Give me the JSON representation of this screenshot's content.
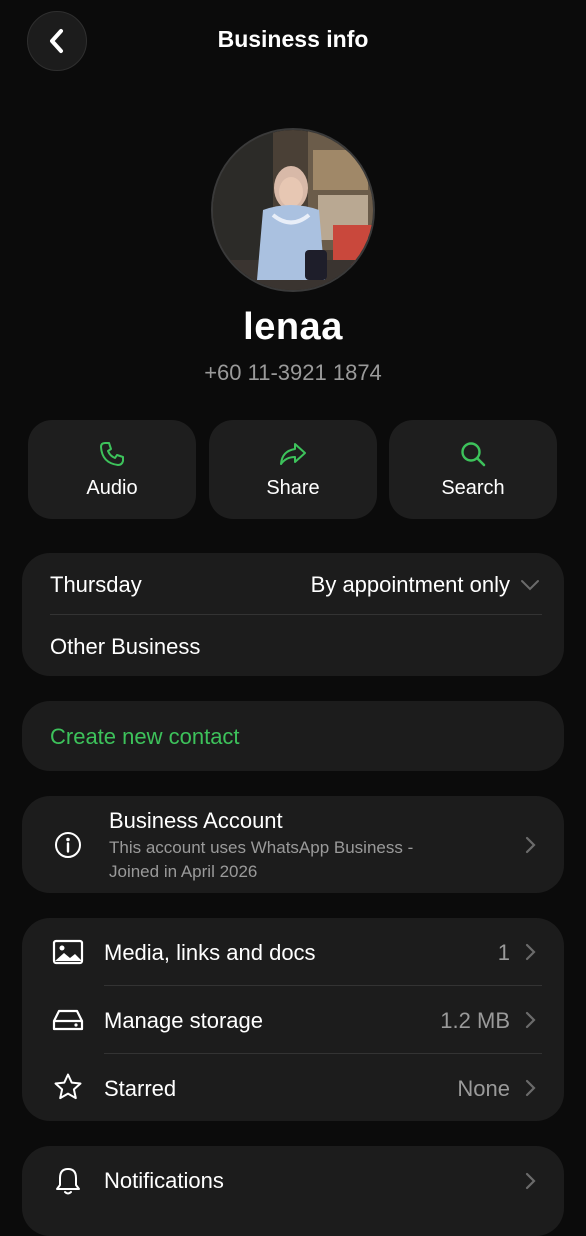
{
  "header": {
    "title": "Business info"
  },
  "profile": {
    "name": "lenaa",
    "phone": "+60 11-3921 1874"
  },
  "actions": [
    {
      "label": "Audio",
      "icon": "phone-icon"
    },
    {
      "label": "Share",
      "icon": "share-icon"
    },
    {
      "label": "Search",
      "icon": "search-icon"
    }
  ],
  "hours": {
    "day": "Thursday",
    "status": "By appointment only",
    "category": "Other Business"
  },
  "create_contact": {
    "label": "Create new contact"
  },
  "business_account": {
    "title": "Business Account",
    "description_line1": "This account uses WhatsApp Business -",
    "description_line2": "Joined in April 2026"
  },
  "media_section": {
    "items": [
      {
        "label": "Media, links and docs",
        "value": "1",
        "icon": "image-icon"
      },
      {
        "label": "Manage storage",
        "value": "1.2 MB",
        "icon": "storage-icon"
      },
      {
        "label": "Starred",
        "value": "None",
        "icon": "star-icon"
      }
    ]
  },
  "notifications": {
    "label": "Notifications",
    "icon": "bell-icon"
  },
  "colors": {
    "accent": "#3dc25b",
    "background": "#0b0b0b",
    "card": "#1c1c1c"
  }
}
